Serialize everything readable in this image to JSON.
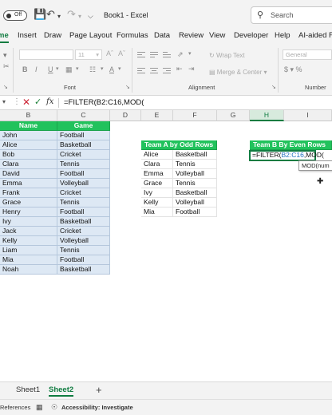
{
  "titlebar": {
    "autosave_state": "Off",
    "doc_title": "Book1 - Excel",
    "search_placeholder": "Search"
  },
  "ribbon": {
    "tabs": [
      "me",
      "Insert",
      "Draw",
      "Page Layout",
      "Formulas",
      "Data",
      "Review",
      "View",
      "Developer",
      "Help",
      "AI-aided Fo"
    ],
    "active_tab_index": 0,
    "font_size_value": "11",
    "wrap_text": "Wrap Text",
    "merge_center": "Merge & Center",
    "number_format": "General",
    "groups": {
      "font": "Font",
      "alignment": "Alignment",
      "number": "Number"
    }
  },
  "formula_bar": {
    "content": "=FILTER(B2:C16,MOD("
  },
  "grid": {
    "columns": [
      "B",
      "C",
      "D",
      "E",
      "F",
      "G",
      "H",
      "I"
    ],
    "active_column": "H",
    "source_table": {
      "headers": [
        "Name",
        "Game"
      ],
      "rows": [
        [
          "John",
          "Football"
        ],
        [
          "Alice",
          "Basketball"
        ],
        [
          "Bob",
          "Cricket"
        ],
        [
          "Clara",
          "Tennis"
        ],
        [
          "David",
          "Football"
        ],
        [
          "Emma",
          "Volleyball"
        ],
        [
          "Frank",
          "Cricket"
        ],
        [
          "Grace",
          "Tennis"
        ],
        [
          "Henry",
          "Football"
        ],
        [
          "Ivy",
          "Basketball"
        ],
        [
          "Jack",
          "Cricket"
        ],
        [
          "Kelly",
          "Volleyball"
        ],
        [
          "Liam",
          "Tennis"
        ],
        [
          "Mia",
          "Football"
        ],
        [
          "Noah",
          "Basketball"
        ]
      ]
    },
    "team_a": {
      "title": "Team A by Odd Rows",
      "rows": [
        [
          "Alice",
          "Basketball"
        ],
        [
          "Clara",
          "Tennis"
        ],
        [
          "Emma",
          "Volleyball"
        ],
        [
          "Grace",
          "Tennis"
        ],
        [
          "Ivy",
          "Basketball"
        ],
        [
          "Kelly",
          "Volleyball"
        ],
        [
          "Mia",
          "Football"
        ]
      ]
    },
    "team_b": {
      "title": "Team B By Even Rows",
      "editing_prefix": "=FILTER(",
      "editing_ref": "B2:C16",
      "editing_suffix": ",MOD(",
      "tooltip": "MOD(num"
    }
  },
  "sheets": {
    "tabs": [
      "Sheet1",
      "Sheet2"
    ],
    "active_index": 1,
    "add_label": "+"
  },
  "status": {
    "left_text": "References",
    "accessibility": "Accessibility: Investigate"
  },
  "colors": {
    "accent": "#107c41",
    "header_green": "#21c25c",
    "data_blue": "#dde8f4"
  }
}
